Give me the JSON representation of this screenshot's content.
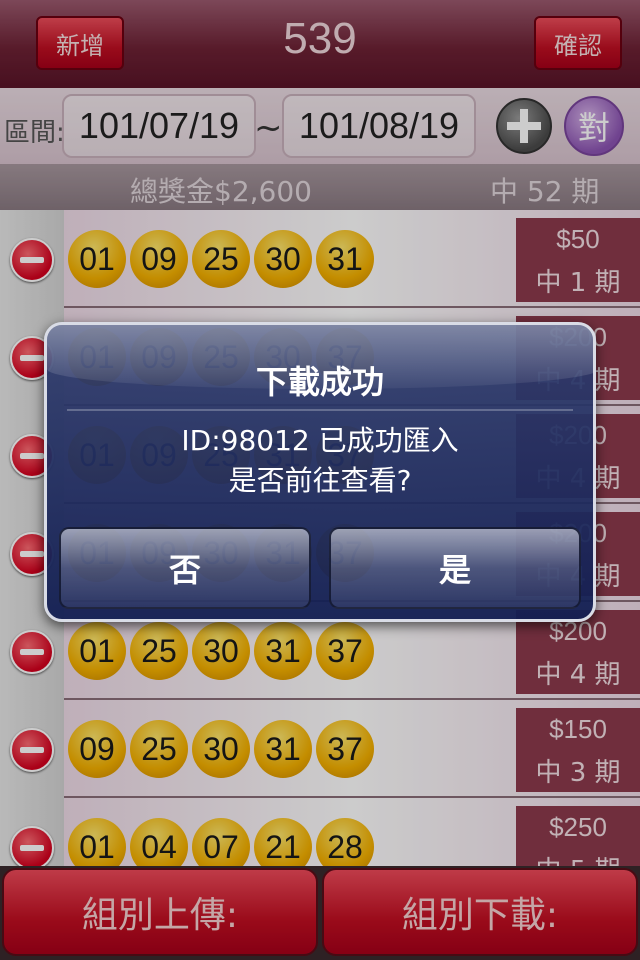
{
  "navbar": {
    "title": "539",
    "add_label": "新增",
    "confirm_label": "確認"
  },
  "range": {
    "label": "區間:",
    "start": "101/07/19",
    "separator": "~",
    "end": "101/08/19",
    "check_label": "對"
  },
  "summary": {
    "total": "總獎金$2,600",
    "hits": "中 52 期"
  },
  "rows": [
    {
      "balls": [
        "01",
        "09",
        "25",
        "30",
        "31"
      ],
      "prize": "$50",
      "period": "中 1 期"
    },
    {
      "balls": [
        "01",
        "09",
        "25",
        "30",
        "37"
      ],
      "prize": "$200",
      "period": "中 4 期"
    },
    {
      "balls": [
        "01",
        "09",
        "25",
        "31",
        "37"
      ],
      "prize": "$200",
      "period": "中 4 期"
    },
    {
      "balls": [
        "01",
        "09",
        "30",
        "31",
        "37"
      ],
      "prize": "$200",
      "period": "中 4 期"
    },
    {
      "balls": [
        "01",
        "25",
        "30",
        "31",
        "37"
      ],
      "prize": "$200",
      "period": "中 4 期"
    },
    {
      "balls": [
        "09",
        "25",
        "30",
        "31",
        "37"
      ],
      "prize": "$150",
      "period": "中 3 期"
    },
    {
      "balls": [
        "01",
        "04",
        "07",
        "21",
        "28"
      ],
      "prize": "$250",
      "period": "中 5 期"
    }
  ],
  "bottom": {
    "upload_label": "組別上傳:",
    "download_label": "組別下載:"
  },
  "alert": {
    "title": "下載成功",
    "message_line1": "ID:98012 已成功匯入",
    "message_line2": "是否前往查看?",
    "no_label": "否",
    "yes_label": "是"
  },
  "icons": {
    "add": "plus-icon",
    "delete": "minus-circle-icon"
  }
}
